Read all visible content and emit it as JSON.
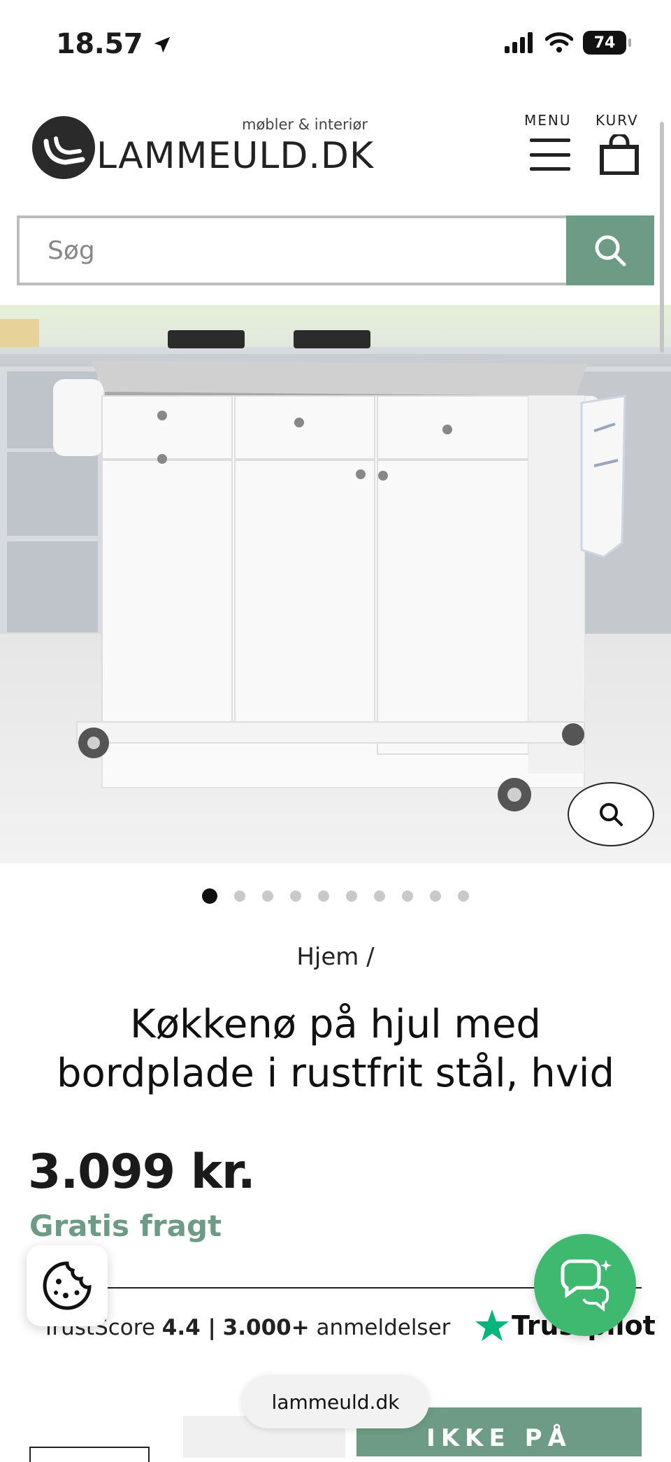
{
  "status_bar": {
    "time": "18.57",
    "battery": "74"
  },
  "header": {
    "logo_text": "LAMMEULD.DK",
    "logo_tagline": "møbler & interiør",
    "menu_label": "MENU",
    "cart_label": "KURV"
  },
  "search": {
    "placeholder": "Søg"
  },
  "carousel": {
    "total": 10,
    "active": 0
  },
  "breadcrumb": "Hjem /",
  "product": {
    "title": "Køkkenø på hjul med bordplade i rustfrit stål, hvid",
    "price": "3.099 kr.",
    "shipping": "Gratis fragt"
  },
  "trustpilot": {
    "prefix": "TrustScore",
    "score": "4.4 |",
    "count": "3.000+",
    "suffix": "anmeldelser",
    "brand": "Trustpilot"
  },
  "browser": {
    "url": "lammeuld.dk"
  },
  "cta": {
    "label": "IKKE PÅ"
  },
  "colors": {
    "accent": "#6d9b86",
    "chat": "#3fb96f",
    "trustpilot_star": "#00b67a"
  }
}
